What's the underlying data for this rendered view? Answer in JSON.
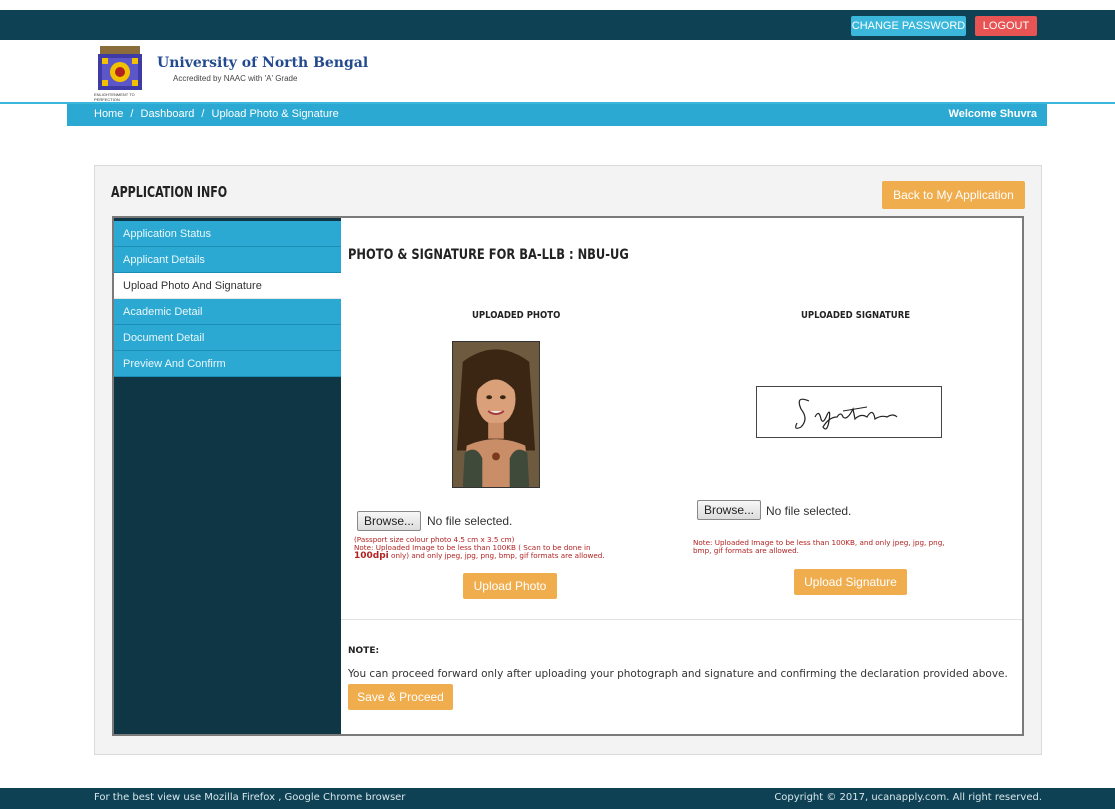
{
  "top": {
    "change_password": "CHANGE PASSWORD",
    "logout": "LOGOUT"
  },
  "header": {
    "university": "University of North Bengal",
    "accreditation": "Accredited by NAAC with 'A' Grade",
    "logo_tagline": "ENLIGHTENMENT TO PERFECTION"
  },
  "breadcrumb": {
    "home": "Home",
    "dashboard": "Dashboard",
    "current": "Upload Photo & Signature",
    "separator": "/",
    "welcome": "Welcome Shuvra"
  },
  "panel": {
    "title": "APPLICATION INFO",
    "back_button": "Back to My Application"
  },
  "sidebar": {
    "items": [
      {
        "label": "Application Status"
      },
      {
        "label": "Applicant Details"
      },
      {
        "label": "Upload Photo And Signature"
      },
      {
        "label": "Academic Detail"
      },
      {
        "label": "Document Detail"
      },
      {
        "label": "Preview And Confirm"
      }
    ]
  },
  "content": {
    "title": "PHOTO & SIGNATURE FOR BA-LLB : NBU-UG",
    "photo": {
      "heading": "UPLOADED PHOTO",
      "browse": "Browse...",
      "nofile": "No file selected.",
      "note_line1": "(Passport size colour photo 4.5 cm x 3.5 cm)",
      "note_line2": "Note: Uploaded Image to be less than 100KB ( Scan to be done in",
      "note_dpi": "100dpi",
      "note_line3": " only) and only jpeg, jpg, png, bmp, gif formats are allowed.",
      "upload": "Upload Photo"
    },
    "signature": {
      "heading": "UPLOADED SIGNATURE",
      "browse": "Browse...",
      "nofile": "No file selected.",
      "note_line1": "Note: Uploaded Image to be less than 100KB, and only jpeg, jpg, png,",
      "note_line2": "bmp, gif formats are allowed.",
      "upload": "Upload Signature",
      "signature_text": "Signature"
    },
    "note_label": "NOTE:",
    "note_text": "You can proceed forward only after uploading your photograph and signature and confirming the declaration provided above.",
    "save": "Save & Proceed"
  },
  "footer": {
    "left": "For the best view use Mozilla Firefox , Google Chrome browser",
    "right": "Copyright © 2017, ucanapply.com. All right reserved."
  },
  "colors": {
    "dark_teal": "#0f4154",
    "accent_blue": "#2ba9d2",
    "orange": "#f0ad4e",
    "red": "#e85353"
  }
}
